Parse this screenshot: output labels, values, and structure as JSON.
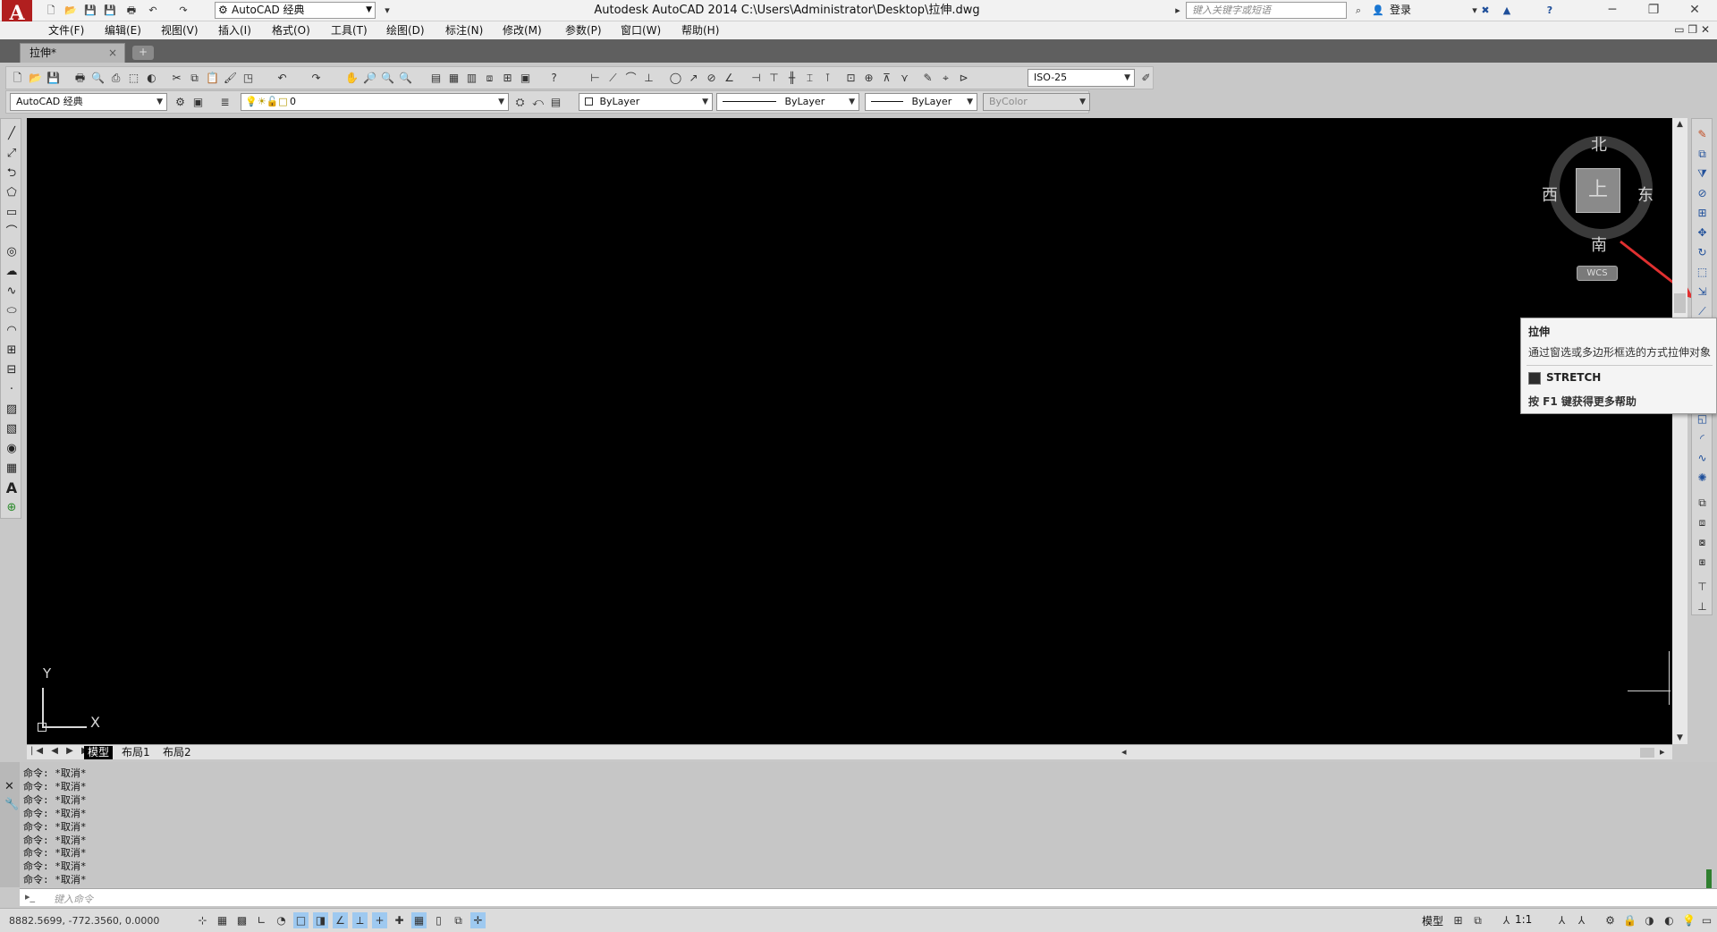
{
  "window": {
    "logo": "A",
    "workspace": "AutoCAD 经典",
    "title": "Autodesk AutoCAD 2014    C:\\Users\\Administrator\\Desktop\\拉伸.dwg",
    "search_placeholder": "键入关键字或短语",
    "login": "登录",
    "help": "?",
    "min": "─",
    "restore": "❐",
    "close": "✕"
  },
  "menu": [
    "文件(F)",
    "编辑(E)",
    "视图(V)",
    "插入(I)",
    "格式(O)",
    "工具(T)",
    "绘图(D)",
    "标注(N)",
    "修改(M)",
    "参数(P)",
    "窗口(W)",
    "帮助(H)"
  ],
  "document_tab": {
    "label": "拉伸*",
    "close": "×",
    "new": "+"
  },
  "toolbar": {
    "dim_style": "ISO-25",
    "workspace2": "AutoCAD 经典",
    "layer": "0",
    "color": "ByLayer",
    "linetype": "ByLayer",
    "lineweight": "ByLayer",
    "plotstyle": "ByColor"
  },
  "viewcube": {
    "north": "北",
    "south": "南",
    "east": "东",
    "west": "西",
    "face": "上",
    "wcs": "WCS"
  },
  "ucs": {
    "x": "X",
    "y": "Y"
  },
  "layout_tabs": [
    "模型",
    "布局1",
    "布局2"
  ],
  "tooltip": {
    "title": "拉伸",
    "description": "通过窗选或多边形框选的方式拉伸对象",
    "command": "STRETCH",
    "help": "按 F1 键获得更多帮助"
  },
  "command_history": [
    "命令: *取消*",
    "命令: *取消*",
    "命令: *取消*",
    "命令: *取消*",
    "命令: *取消*",
    "命令: *取消*",
    "命令: *取消*",
    "命令: *取消*",
    "命令: *取消*"
  ],
  "command_input": {
    "placeholder": "键入命令",
    "prefix": "▸_"
  },
  "status": {
    "coords": "8882.5699, -772.3560, 0.0000",
    "model": "模型",
    "scale": "1:1"
  },
  "colors": {
    "canvas": "#000000",
    "tooltip_bg": "#f4f4f4",
    "annotation_arrow": "#e03030",
    "logo": "#b11f1f"
  }
}
